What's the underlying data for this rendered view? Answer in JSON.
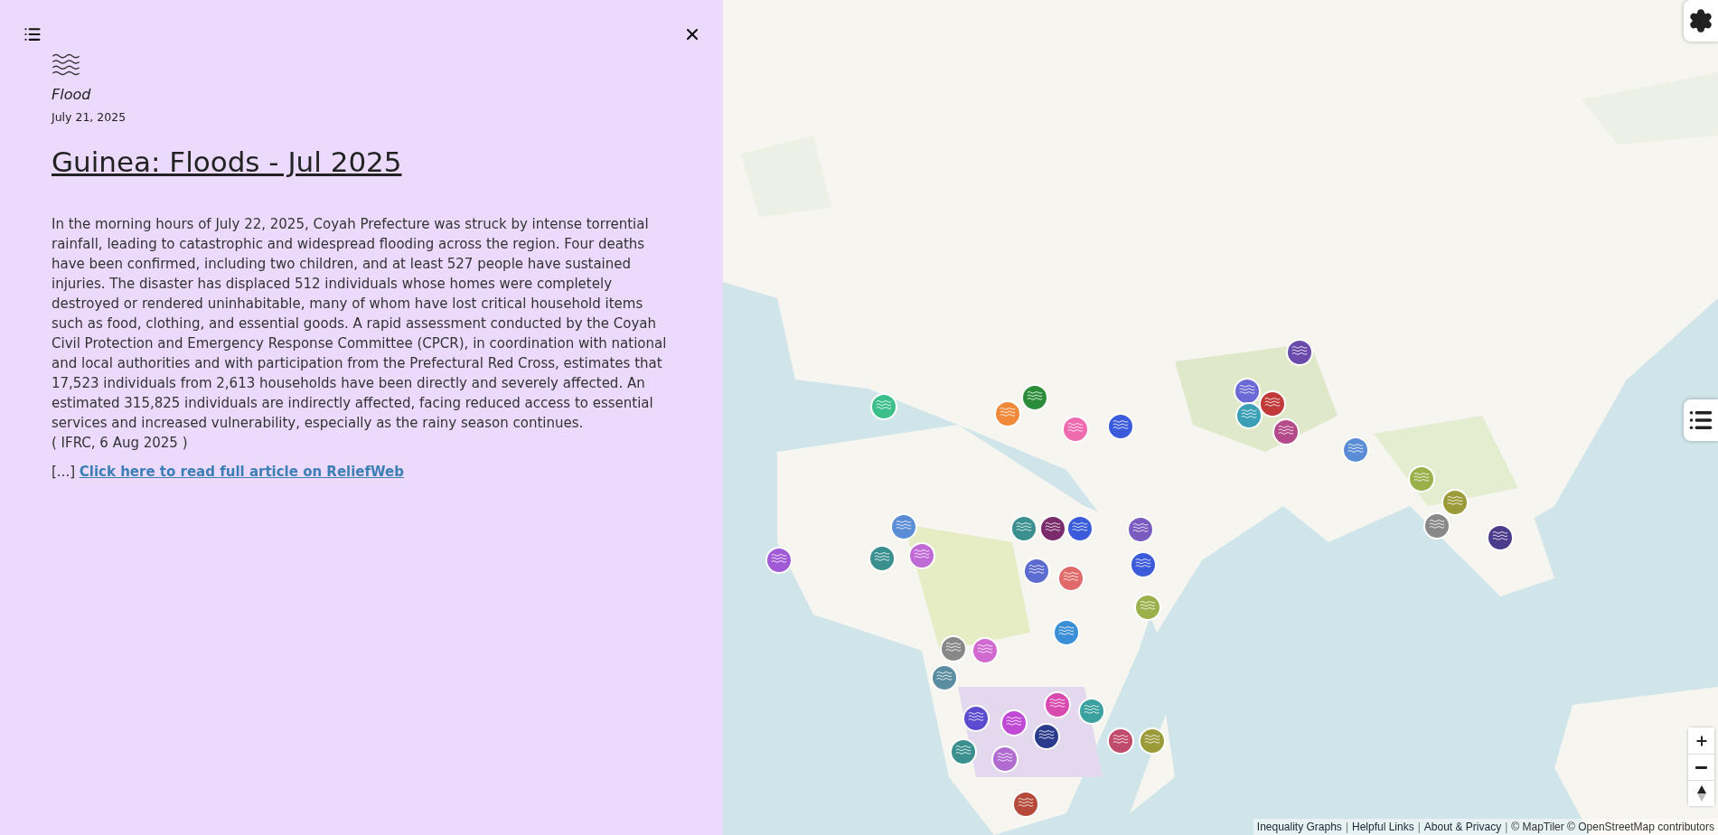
{
  "panel": {
    "category": "Flood",
    "date": "July 21, 2025",
    "title": "Guinea: Floods - Jul 2025",
    "body": "In the morning hours of July 22, 2025, Coyah Prefecture was struck by intense torrential rainfall, leading to catastrophic and widespread flooding across the region. Four deaths have been confirmed, including two children, and at least 527 people have sustained injuries. The disaster has displaced 512 individuals whose homes were completely destroyed or rendered uninhabitable, many of whom have lost critical household items such as food, clothing, and essential goods. A rapid assessment conducted by the Coyah Civil Protection and Emergency Response Committee (CPCR), in coordination with national and local authorities and with participation from the Prefectural Red Cross, estimates that 17,523 individuals from 2,613 households have been directly and severely affected. An estimated 315,825 individuals are indirectly affected, facing reduced access to essential services and increased vulnerability, especially as the rainy season continues.",
    "source": "( IFRC, 6 Aug 2025 )",
    "more_prefix": "[...]",
    "more_link": "Click here to read full article on ReliefWeb"
  },
  "attribution": [
    {
      "kind": "link",
      "text": "Inequality Graphs"
    },
    {
      "kind": "separator",
      "text": "|"
    },
    {
      "kind": "link",
      "text": "Helpful Links"
    },
    {
      "kind": "separator",
      "text": "|"
    },
    {
      "kind": "link",
      "text": "About & Privacy"
    },
    {
      "kind": "separator",
      "text": "|"
    },
    {
      "kind": "text",
      "text": "© MapTiler © OpenStreetMap contributors"
    }
  ]
}
